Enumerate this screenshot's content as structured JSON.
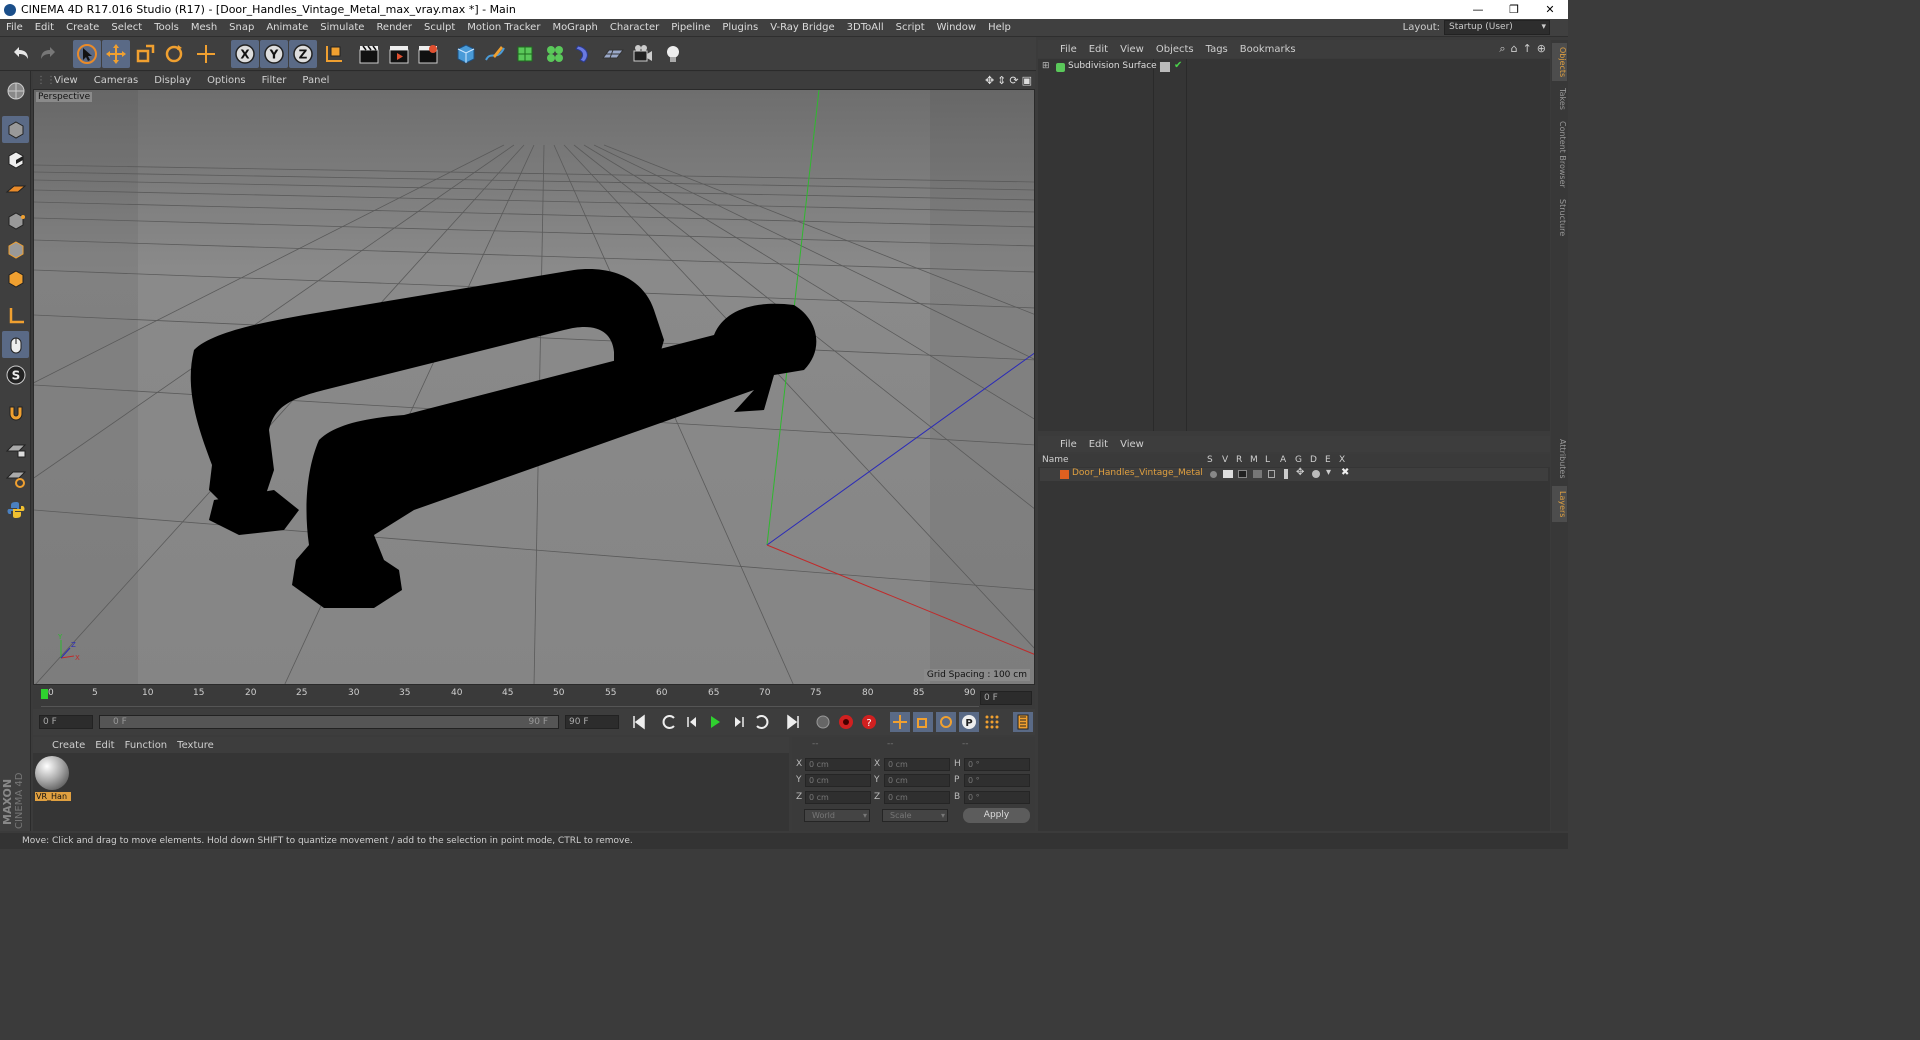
{
  "window": {
    "title": "CINEMA 4D R17.016 Studio (R17) - [Door_Handles_Vintage_Metal_max_vray.max *] - Main",
    "minimize": "—",
    "restore": "❐",
    "close": "✕"
  },
  "menubar": {
    "items": [
      "File",
      "Edit",
      "Create",
      "Select",
      "Tools",
      "Mesh",
      "Snap",
      "Animate",
      "Simulate",
      "Render",
      "Sculpt",
      "Motion Tracker",
      "MoGraph",
      "Character",
      "Pipeline",
      "Plugins",
      "V-Ray Bridge",
      "3DToAll",
      "Script",
      "Window",
      "Help"
    ],
    "layout_label": "Layout:",
    "layout_value": "Startup (User)"
  },
  "viewport": {
    "menu": [
      "View",
      "Cameras",
      "Display",
      "Options",
      "Filter",
      "Panel"
    ],
    "label": "Perspective",
    "grid_spacing": "Grid Spacing : 100 cm"
  },
  "timeline": {
    "ticks": [
      "0",
      "5",
      "10",
      "15",
      "20",
      "25",
      "30",
      "35",
      "40",
      "45",
      "50",
      "55",
      "60",
      "65",
      "70",
      "75",
      "80",
      "85",
      "90"
    ],
    "current_frame": "0 F",
    "start_field": "0 F",
    "range_start": "0 F",
    "range_end": "90 F",
    "end_field": "90 F"
  },
  "material_manager": {
    "menu": [
      "Create",
      "Edit",
      "Function",
      "Texture"
    ],
    "materials": [
      {
        "name": "VR_Han"
      }
    ]
  },
  "coordinates": {
    "headers": [
      "--",
      "--",
      "--"
    ],
    "rows": [
      {
        "l1": "X",
        "v1": "0 cm",
        "l2": "X",
        "v2": "0 cm",
        "l3": "H",
        "v3": "0 °"
      },
      {
        "l1": "Y",
        "v1": "0 cm",
        "l2": "Y",
        "v2": "0 cm",
        "l3": "P",
        "v3": "0 °"
      },
      {
        "l1": "Z",
        "v1": "0 cm",
        "l2": "Z",
        "v2": "0 cm",
        "l3": "B",
        "v3": "0 °"
      }
    ],
    "space": "World",
    "mode": "Scale",
    "apply": "Apply"
  },
  "object_manager": {
    "menu": [
      "File",
      "Edit",
      "View",
      "Objects",
      "Tags",
      "Bookmarks"
    ],
    "objects": [
      {
        "name": "Subdivision Surface"
      }
    ]
  },
  "layer_manager": {
    "menu": [
      "File",
      "Edit",
      "View"
    ],
    "columns": [
      "Name",
      "S",
      "V",
      "R",
      "M",
      "L",
      "A",
      "G",
      "D",
      "E",
      "X"
    ],
    "layers": [
      {
        "name": "Door_Handles_Vintage_Metal",
        "color": "#e06020"
      }
    ]
  },
  "side_tabs": [
    "Objects",
    "Takes",
    "Content Browser",
    "Structure",
    "Attributes",
    "Layers"
  ],
  "status": "Move: Click and drag to move elements. Hold down SHIFT to quantize movement / add to the selection in point mode, CTRL to remove.",
  "logo": {
    "line1": "MAXON",
    "line2": "CINEMA 4D"
  },
  "colors": {
    "accent": "#5a6a86",
    "highlight": "#e0a040"
  }
}
